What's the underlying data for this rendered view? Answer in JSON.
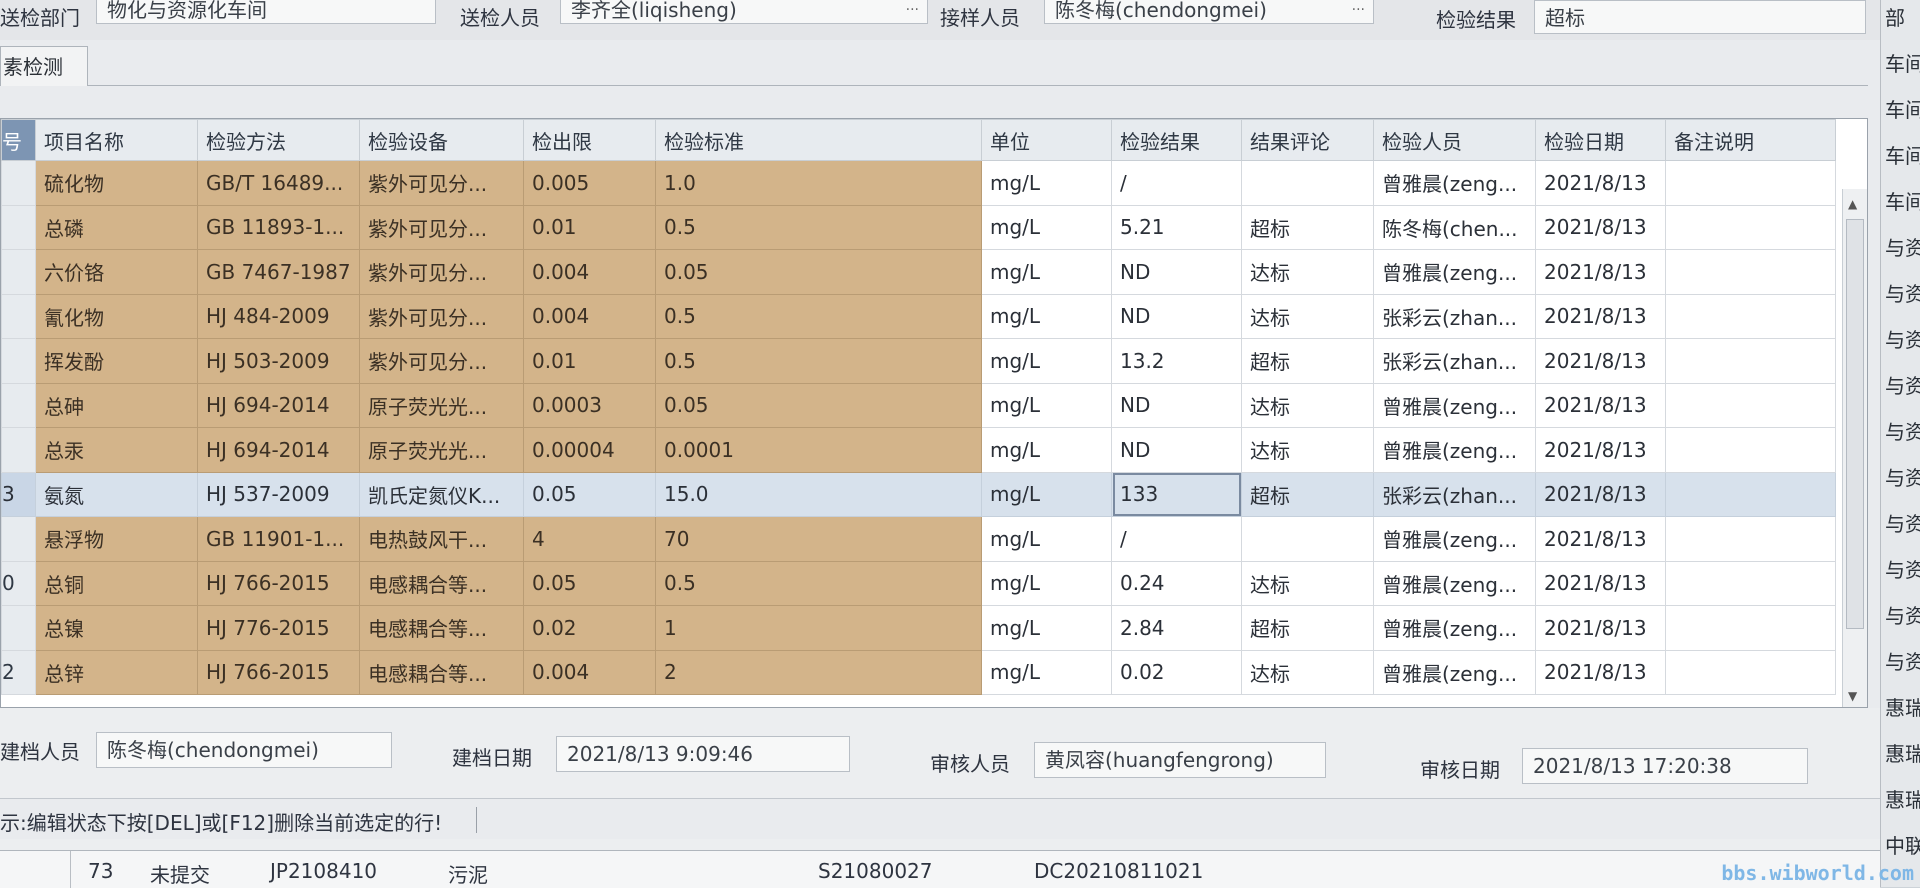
{
  "header": {
    "dept_label": "送检部门",
    "dept_value": "物化与资源化车间",
    "sender_label": "送检人员",
    "sender_value": "李齐全(liqisheng)",
    "receiver_label": "接样人员",
    "receiver_value": "陈冬梅(chendongmei)",
    "result_label": "检验结果",
    "result_value": "超标"
  },
  "tab": {
    "label": "素检测"
  },
  "table": {
    "columns": [
      "号",
      "项目名称",
      "检验方法",
      "检验设备",
      "检出限",
      "检验标准",
      "单位",
      "检验结果",
      "结果评论",
      "检验人员",
      "检验日期",
      "备注说明"
    ],
    "rows": [
      {
        "num": "",
        "name": "硫化物",
        "method": "GB/T 16489...",
        "device": "紫外可见分...",
        "limit": "0.005",
        "standard": "1.0",
        "unit": "mg/L",
        "result": "/",
        "comment": "",
        "inspector": "曾雅晨(zeng...",
        "date": "2021/8/13",
        "note": ""
      },
      {
        "num": "",
        "name": "总磷",
        "method": "GB 11893-1...",
        "device": "紫外可见分...",
        "limit": "0.01",
        "standard": "0.5",
        "unit": "mg/L",
        "result": "5.21",
        "comment": "超标",
        "inspector": "陈冬梅(chen...",
        "date": "2021/8/13",
        "note": ""
      },
      {
        "num": "",
        "name": "六价铬",
        "method": "GB 7467-1987",
        "device": "紫外可见分...",
        "limit": "0.004",
        "standard": "0.05",
        "unit": "mg/L",
        "result": "ND",
        "comment": "达标",
        "inspector": "曾雅晨(zeng...",
        "date": "2021/8/13",
        "note": ""
      },
      {
        "num": "",
        "name": "氰化物",
        "method": "HJ 484-2009",
        "device": "紫外可见分...",
        "limit": "0.004",
        "standard": "0.5",
        "unit": "mg/L",
        "result": "ND",
        "comment": "达标",
        "inspector": "张彩云(zhan...",
        "date": "2021/8/13",
        "note": ""
      },
      {
        "num": "",
        "name": "挥发酚",
        "method": "HJ 503-2009",
        "device": "紫外可见分...",
        "limit": "0.01",
        "standard": "0.5",
        "unit": "mg/L",
        "result": "13.2",
        "comment": "超标",
        "inspector": "张彩云(zhan...",
        "date": "2021/8/13",
        "note": ""
      },
      {
        "num": "",
        "name": "总砷",
        "method": "HJ 694-2014",
        "device": "原子荧光光...",
        "limit": "0.0003",
        "standard": "0.05",
        "unit": "mg/L",
        "result": "ND",
        "comment": "达标",
        "inspector": "曾雅晨(zeng...",
        "date": "2021/8/13",
        "note": ""
      },
      {
        "num": "",
        "name": "总汞",
        "method": "HJ 694-2014",
        "device": "原子荧光光...",
        "limit": "0.00004",
        "standard": "0.0001",
        "unit": "mg/L",
        "result": "ND",
        "comment": "达标",
        "inspector": "曾雅晨(zeng...",
        "date": "2021/8/13",
        "note": ""
      },
      {
        "num": "3",
        "name": "氨氮",
        "method": "HJ 537-2009",
        "device": "凯氏定氮仪K...",
        "limit": "0.05",
        "standard": "15.0",
        "unit": "mg/L",
        "result": "133",
        "comment": "超标",
        "inspector": "张彩云(zhan...",
        "date": "2021/8/13",
        "note": "",
        "selected": true
      },
      {
        "num": "",
        "name": "悬浮物",
        "method": "GB 11901-1...",
        "device": "电热鼓风干...",
        "limit": "4",
        "standard": "70",
        "unit": "mg/L",
        "result": "/",
        "comment": "",
        "inspector": "曾雅晨(zeng...",
        "date": "2021/8/13",
        "note": ""
      },
      {
        "num": "0",
        "name": "总铜",
        "method": "HJ 766-2015",
        "device": "电感耦合等...",
        "limit": "0.05",
        "standard": "0.5",
        "unit": "mg/L",
        "result": "0.24",
        "comment": "达标",
        "inspector": "曾雅晨(zeng...",
        "date": "2021/8/13",
        "note": ""
      },
      {
        "num": "",
        "name": "总镍",
        "method": "HJ 776-2015",
        "device": "电感耦合等...",
        "limit": "0.02",
        "standard": "1",
        "unit": "mg/L",
        "result": "2.84",
        "comment": "超标",
        "inspector": "曾雅晨(zeng...",
        "date": "2021/8/13",
        "note": ""
      },
      {
        "num": "2",
        "name": "总锌",
        "method": "HJ 766-2015",
        "device": "电感耦合等...",
        "limit": "0.004",
        "standard": "2",
        "unit": "mg/L",
        "result": "0.02",
        "comment": "达标",
        "inspector": "曾雅晨(zeng...",
        "date": "2021/8/13",
        "note": ""
      }
    ]
  },
  "footer": {
    "creator_label": "建档人员",
    "creator_value": "陈冬梅(chendongmei)",
    "create_date_label": "建档日期",
    "create_date_value": "2021/8/13 9:09:46",
    "reviewer_label": "审核人员",
    "reviewer_value": "黄凤容(huangfengrong)",
    "review_date_label": "审核日期",
    "review_date_value": "2021/8/13 17:20:38"
  },
  "status": {
    "text": "示:编辑状态下按[DEL]或[F12]删除当前选定的行!"
  },
  "background_list": {
    "row_num": "73",
    "status": "未提交",
    "code": "JP2108410",
    "type": "污泥",
    "sample": "S21080027",
    "doc": "DC20210811021"
  },
  "right_column": [
    "部",
    "车间",
    "车间",
    "车间",
    "车间",
    "与资",
    "与资",
    "与资",
    "与资",
    "与资",
    "与资",
    "与资",
    "与资",
    "与资",
    "与资",
    "惠瑞光",
    "惠瑞光",
    "惠瑞光",
    "中联环"
  ],
  "watermark": "bbs.wibworld.com"
}
